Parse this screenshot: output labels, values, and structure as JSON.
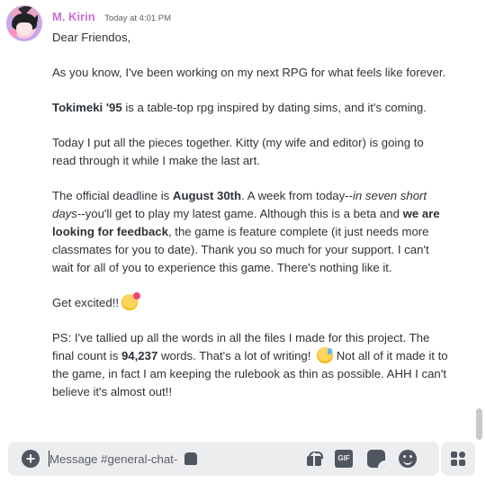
{
  "message": {
    "username": "M. Kirin",
    "timestamp": "Today at 4:01 PM",
    "greeting": "Dear Friendos,",
    "p1": "As you know, I've been working on my next RPG for what feels like forever.",
    "p2_bold": "Tokimeki '95",
    "p2_rest": " is a table-top rpg inspired by dating sims, and it's coming.",
    "p3": "Today I put all the pieces together. Kitty (my wife and editor) is going to read through it while I make the last art.",
    "p4_a": "The official deadline is ",
    "p4_date": "August 30th",
    "p4_b": ". A week from today--",
    "p4_italic": "in seven short days",
    "p4_c": "--you'll get to play my latest game. Although this is a beta and ",
    "p4_bold2": "we are looking for feedback",
    "p4_d": ", the game is feature complete (it just needs more classmates for you to date). Thank you so much for your support. I can't wait for all of you to experience this game. There's nothing like it.",
    "p5": "Get excited!!",
    "p6_a": "PS: I've tallied up all the words in all the files I made for this project. The final count is ",
    "p6_count": "94,237",
    "p6_b": " words. That's a lot of writing! ",
    "p6_c": " Not all of it made it to the game, in fact I am keeping the rulebook as thin as possible. AHH I can't believe it's almost out!!"
  },
  "composer": {
    "placeholder": "Message #general-chat-",
    "gif_label": "GIF"
  },
  "icons": {
    "avatar": "cat-girl-avatar",
    "emoji_1": "smiling-face-with-hearts",
    "emoji_2": "grinning-face-with-sweat"
  },
  "colors": {
    "username": "#c76ed8",
    "text": "#2e3338",
    "composer_bg": "#ebedef",
    "icon": "#4f5660"
  }
}
